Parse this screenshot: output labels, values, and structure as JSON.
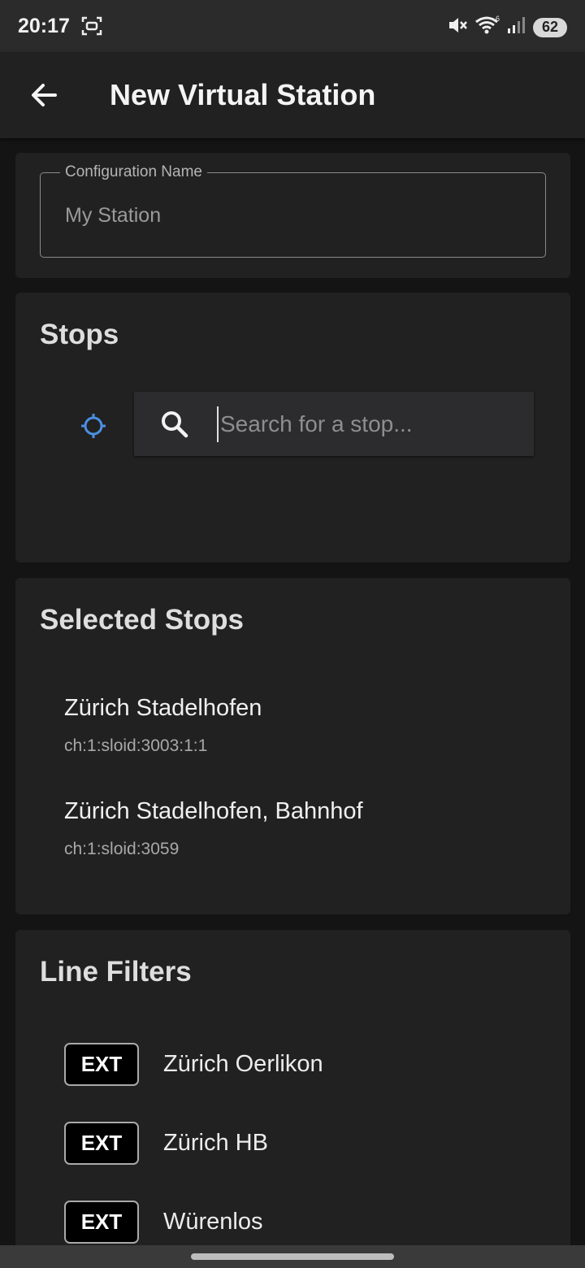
{
  "status_bar": {
    "time": "20:17",
    "battery": "62",
    "icons": [
      "screenshot-icon",
      "mute-icon",
      "wifi-icon",
      "signal-icon"
    ]
  },
  "app_bar": {
    "back_icon": "arrow-left-icon",
    "title": "New Virtual Station"
  },
  "config": {
    "label": "Configuration Name",
    "value": "My Station"
  },
  "stops": {
    "title": "Stops",
    "locate_icon": "crosshair-icon",
    "search_placeholder": "Search for a stop..."
  },
  "selected_stops": {
    "title": "Selected Stops",
    "items": [
      {
        "name": "Zürich Stadelhofen",
        "id": "ch:1:sloid:3003:1:1"
      },
      {
        "name": "Zürich Stadelhofen, Bahnhof",
        "id": "ch:1:sloid:3059"
      }
    ]
  },
  "line_filters": {
    "title": "Line Filters",
    "items": [
      {
        "badge": "EXT",
        "label": "Zürich Oerlikon"
      },
      {
        "badge": "EXT",
        "label": "Zürich HB"
      },
      {
        "badge": "EXT",
        "label": "Würenlos"
      }
    ]
  },
  "colors": {
    "accent": "#4a90e2",
    "surface": "#212121",
    "background": "#141414"
  }
}
